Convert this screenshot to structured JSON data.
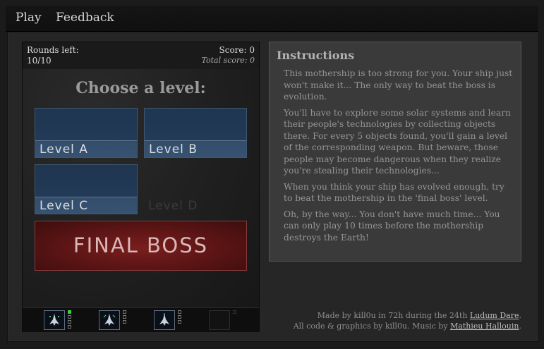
{
  "nav": {
    "play": "Play",
    "feedback": "Feedback"
  },
  "game": {
    "rounds_label": "Rounds left:",
    "rounds_value": "10/10",
    "score": "Score: 0",
    "total_score": "Total score: 0",
    "choose_title": "Choose a level:",
    "levels": [
      {
        "label": "Level A",
        "enabled": true
      },
      {
        "label": "Level B",
        "enabled": true
      },
      {
        "label": "Level C",
        "enabled": true
      },
      {
        "label": "Level D",
        "enabled": false
      }
    ],
    "boss_label": "FINAL BOSS",
    "ships": [
      {
        "icon": "ship-icon",
        "pips_on": 1
      },
      {
        "icon": "ship-icon",
        "pips_on": 0
      },
      {
        "icon": "ship-icon",
        "pips_on": 0
      }
    ]
  },
  "instructions": {
    "title": "Instructions",
    "paragraphs": [
      "This mothership is too strong for you. Your ship just won't make it... The only way to beat the boss is evolution.",
      "You'll have to explore some solar systems and learn their people's technologies by collecting objects there. For every 5 objects found, you'll gain a level of the corresponding weapon. But beware, those people may become dangerous when they realize you're stealing their technologies...",
      "When you think your ship has evolved enough, try to beat the mothership in the 'final boss' level.",
      "Oh, by the way... You don't have much time... You can only play 10 times before the mothership destroys the Earth!"
    ]
  },
  "credits": {
    "line1_prefix": "Made by kill0u in 72h during the 24th ",
    "line1_link": "Ludum Dare",
    "line1_suffix": ".",
    "line2_prefix": "All code & graphics by kill0u. Music by ",
    "line2_link": "Mathieu Hallouin",
    "line2_suffix": "."
  },
  "colors": {
    "level_blue": "#223a57",
    "boss_red": "#5a1414",
    "pip_green": "#3bd13b"
  }
}
